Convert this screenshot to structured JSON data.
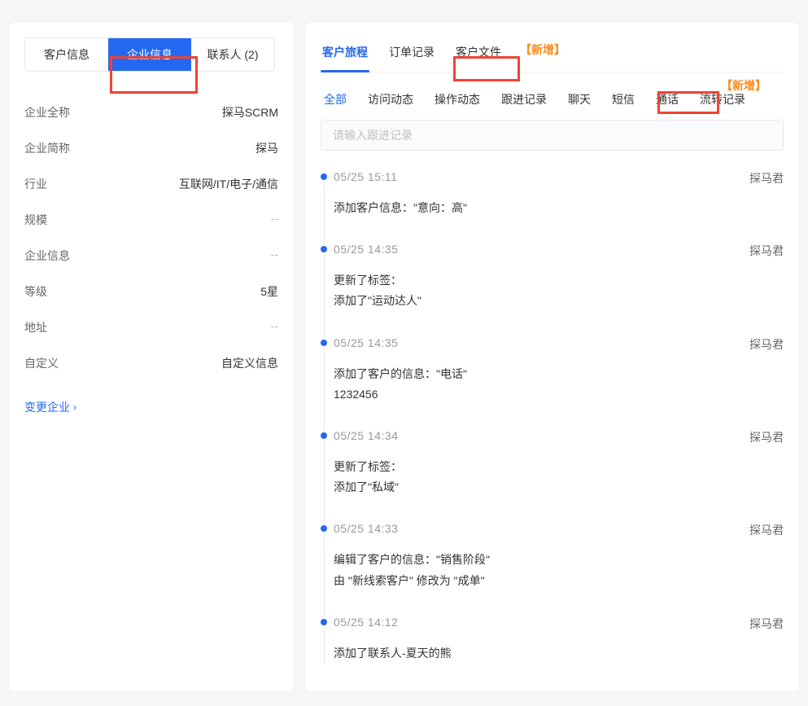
{
  "left_tabs": {
    "customer": "客户信息",
    "enterprise": "企业信息",
    "contacts": "联系人 (2)"
  },
  "form": {
    "labels": {
      "fullname": "企业全称",
      "shortname": "企业简称",
      "industry": "行业",
      "scale": "规模",
      "enterprise_info": "企业信息",
      "level": "等级",
      "address": "地址",
      "custom": "自定义"
    },
    "values": {
      "fullname": "探马SCRM",
      "shortname": "探马",
      "industry": "互联网/IT/电子/通信",
      "scale": "--",
      "enterprise_info": "--",
      "level": "5星",
      "address": "--",
      "custom": "自定义信息"
    },
    "change_link": "变更企业"
  },
  "main_tabs": {
    "journey": "客户旅程",
    "orders": "订单记录",
    "files": "客户文件"
  },
  "sub_tabs": {
    "all": "全部",
    "visit": "访问动态",
    "op": "操作动态",
    "follow": "跟进记录",
    "chat": "聊天",
    "sms": "短信",
    "call": "通话",
    "transfer": "流转记录"
  },
  "input": {
    "placeholder": "请输入跟进记录"
  },
  "new_badge": "【新增】",
  "timeline": [
    {
      "time": "05/25  15:11",
      "author": "探马君",
      "lines": [
        "添加客户信息：\"意向：高\""
      ]
    },
    {
      "time": "05/25  14:35",
      "author": "探马君",
      "lines": [
        "更新了标签：",
        "添加了\"运动达人\""
      ]
    },
    {
      "time": "05/25  14:35",
      "author": "探马君",
      "lines": [
        "添加了客户的信息：\"电话\"",
        "1232456"
      ]
    },
    {
      "time": "05/25  14:34",
      "author": "探马君",
      "lines": [
        "更新了标签：",
        "添加了\"私域\""
      ]
    },
    {
      "time": "05/25  14:33",
      "author": "探马君",
      "lines": [
        "编辑了客户的信息：\"销售阶段\"",
        "由 \"新线索客户\" 修改为 \"成单\""
      ]
    },
    {
      "time": "05/25  14:12",
      "author": "探马君",
      "lines": [
        "添加了联系人-夏天的熊"
      ]
    }
  ]
}
